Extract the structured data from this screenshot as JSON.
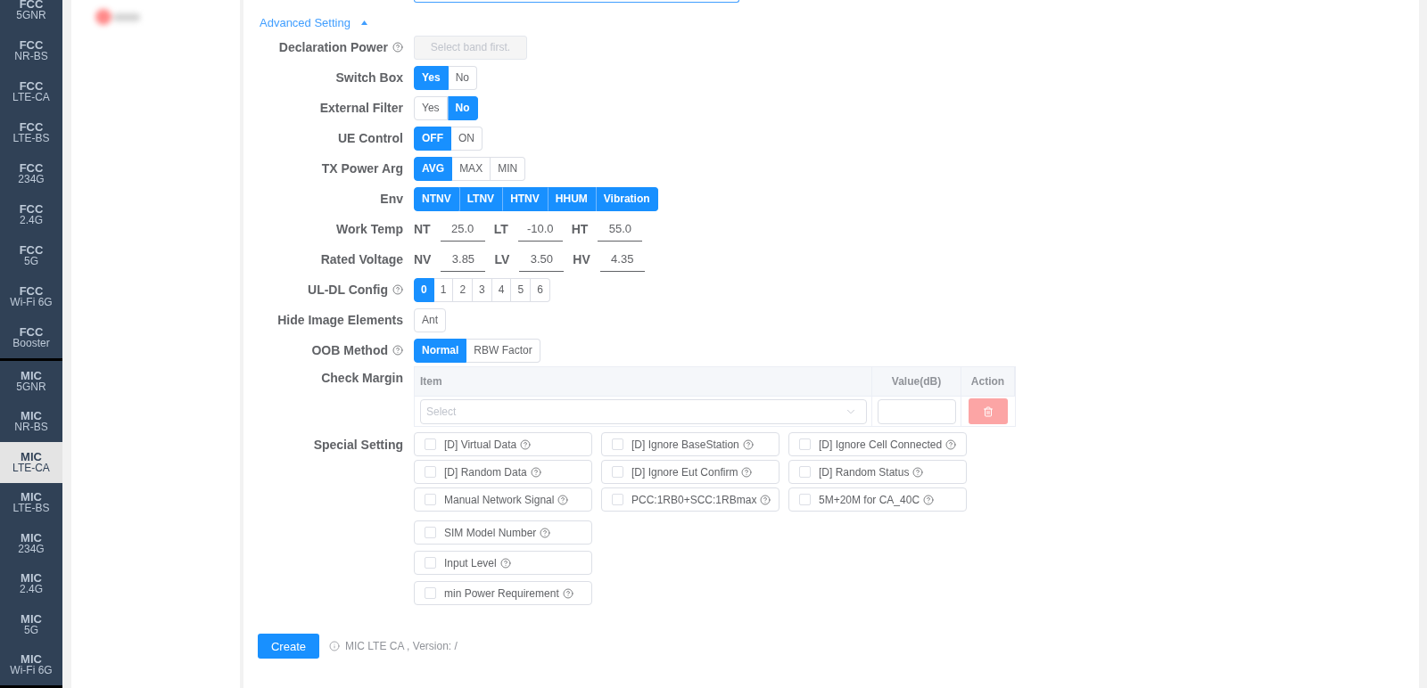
{
  "sidebar": {
    "groups": [
      {
        "items": [
          {
            "brand": "FCC",
            "band": "5GNR",
            "selected": false
          },
          {
            "brand": "FCC",
            "band": "NR-BS",
            "selected": false
          },
          {
            "brand": "FCC",
            "band": "LTE-CA",
            "selected": false
          },
          {
            "brand": "FCC",
            "band": "LTE-BS",
            "selected": false
          },
          {
            "brand": "FCC",
            "band": "234G",
            "selected": false
          },
          {
            "brand": "FCC",
            "band": "2.4G",
            "selected": false
          },
          {
            "brand": "FCC",
            "band": "5G",
            "selected": false
          },
          {
            "brand": "FCC",
            "band": "Wi-Fi 6G",
            "selected": false
          },
          {
            "brand": "FCC",
            "band": "Booster",
            "selected": false
          }
        ]
      },
      {
        "items": [
          {
            "brand": "MIC",
            "band": "5GNR",
            "selected": false
          },
          {
            "brand": "MIC",
            "band": "NR-BS",
            "selected": false
          },
          {
            "brand": "MIC",
            "band": "LTE-CA",
            "selected": true
          },
          {
            "brand": "MIC",
            "band": "LTE-BS",
            "selected": false
          },
          {
            "brand": "MIC",
            "band": "234G",
            "selected": false
          },
          {
            "brand": "MIC",
            "band": "2.4G",
            "selected": false
          },
          {
            "brand": "MIC",
            "band": "5G",
            "selected": false
          },
          {
            "brand": "MIC",
            "band": "Wi-Fi 6G",
            "selected": false
          }
        ]
      }
    ]
  },
  "advanced_toggle": {
    "label": "Advanced Setting",
    "expanded": true
  },
  "form": {
    "rows": [
      {
        "kind": "action",
        "label": "Declaration Power",
        "help": true,
        "button": {
          "label": "Select band first.",
          "disabled": true
        }
      },
      {
        "kind": "radio",
        "label": "Switch Box",
        "help": false,
        "options": [
          {
            "label": "Yes",
            "selected": true
          },
          {
            "label": "No",
            "selected": false
          }
        ]
      },
      {
        "kind": "radio",
        "label": "External Filter",
        "help": false,
        "options": [
          {
            "label": "Yes",
            "selected": false
          },
          {
            "label": "No",
            "selected": true
          }
        ]
      },
      {
        "kind": "radio",
        "label": "UE Control",
        "help": false,
        "options": [
          {
            "label": "OFF",
            "selected": true
          },
          {
            "label": "ON",
            "selected": false
          }
        ]
      },
      {
        "kind": "radio",
        "label": "TX Power Arg",
        "help": false,
        "options": [
          {
            "label": "AVG",
            "selected": true
          },
          {
            "label": "MAX",
            "selected": false
          },
          {
            "label": "MIN",
            "selected": false
          }
        ]
      },
      {
        "kind": "checks",
        "label": "Env",
        "help": false,
        "options": [
          {
            "label": "NTNV",
            "checked": true
          },
          {
            "label": "LTNV",
            "checked": true
          },
          {
            "label": "HTNV",
            "checked": true
          },
          {
            "label": "HHUM",
            "checked": true
          },
          {
            "label": "Vibration",
            "checked": true
          }
        ]
      },
      {
        "kind": "inputs",
        "label": "Work Temp",
        "help": false,
        "fields": [
          {
            "label": "NT",
            "value": "25.0"
          },
          {
            "label": "LT",
            "value": "-10.0"
          },
          {
            "label": "HT",
            "value": "55.0"
          }
        ]
      },
      {
        "kind": "inputs",
        "label": "Rated Voltage",
        "help": false,
        "fields": [
          {
            "label": "NV",
            "value": "3.85"
          },
          {
            "label": "LV",
            "value": "3.50"
          },
          {
            "label": "HV",
            "value": "4.35"
          }
        ]
      },
      {
        "kind": "radio",
        "label": "UL-DL Config",
        "help": true,
        "options": [
          {
            "label": "0",
            "selected": true
          },
          {
            "label": "1",
            "selected": false
          },
          {
            "label": "2",
            "selected": false
          },
          {
            "label": "3",
            "selected": false
          },
          {
            "label": "4",
            "selected": false
          },
          {
            "label": "5",
            "selected": false
          },
          {
            "label": "6",
            "selected": false
          }
        ]
      },
      {
        "kind": "checks",
        "label": "Hide Image Elements",
        "help": false,
        "options": [
          {
            "label": "Ant",
            "checked": false
          }
        ]
      },
      {
        "kind": "radio",
        "label": "OOB Method",
        "help": true,
        "options": [
          {
            "label": "Normal",
            "selected": true
          },
          {
            "label": "RBW Factor",
            "selected": false
          }
        ]
      }
    ]
  },
  "check_margin": {
    "label": "Check Margin",
    "columns": [
      "Item",
      "Value(dB)",
      "Action"
    ],
    "rows": [
      {
        "item": {
          "placeholder": "Select"
        },
        "delete_disabled": true
      }
    ]
  },
  "special_setting": {
    "label": "Special Setting",
    "grid": [
      {
        "label": "[D] Virtual Data",
        "checked": false,
        "help": true
      },
      {
        "label": "[D] Ignore BaseStation",
        "checked": false,
        "help": true
      },
      {
        "label": "[D] Ignore Cell Connected",
        "checked": false,
        "help": true
      },
      {
        "label": "[D] Random Data",
        "checked": false,
        "help": true
      },
      {
        "label": "[D] Ignore Eut Confirm",
        "checked": false,
        "help": true
      },
      {
        "label": "[D] Random Status",
        "checked": false,
        "help": true
      },
      {
        "label": "Manual Network Signal",
        "checked": false,
        "help": true
      },
      {
        "label": "PCC:1RB0+SCC:1RBmax",
        "checked": false,
        "help": true
      },
      {
        "label": "5M+20M for CA_40C",
        "checked": false,
        "help": true
      }
    ],
    "list": [
      {
        "label": "SIM Model Number",
        "checked": false,
        "help": true
      },
      {
        "label": "Input Level",
        "checked": false,
        "help": true
      },
      {
        "label": "min Power Requirement",
        "checked": false,
        "help": true
      }
    ]
  },
  "footer": {
    "button": "Create",
    "info": "MIC LTE CA , Version: /"
  }
}
